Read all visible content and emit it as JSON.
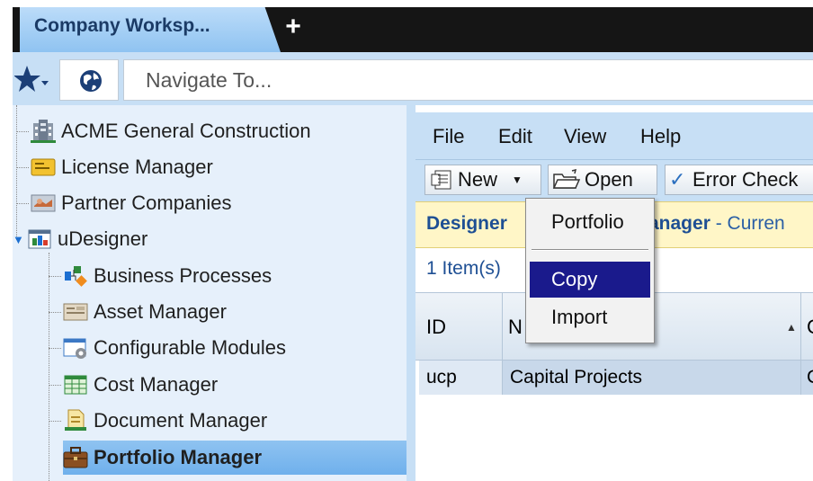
{
  "tab": {
    "title": "Company Worksp...",
    "add_label": "+"
  },
  "nav": {
    "placeholder": "Navigate To..."
  },
  "tree": {
    "items": [
      {
        "label": "ACME General Construction"
      },
      {
        "label": "License Manager"
      },
      {
        "label": "Partner Companies"
      },
      {
        "label": "uDesigner"
      },
      {
        "label": "Business Processes"
      },
      {
        "label": "Asset Manager"
      },
      {
        "label": "Configurable Modules"
      },
      {
        "label": "Cost Manager"
      },
      {
        "label": "Document Manager"
      },
      {
        "label": "Portfolio Manager"
      }
    ]
  },
  "menu": {
    "file": "File",
    "edit": "Edit",
    "view": "View",
    "help": "Help"
  },
  "toolbar": {
    "new": "New",
    "open": "Open",
    "error_check": "Error Check"
  },
  "designer": {
    "label": "Designer",
    "mgr": "anager",
    "current": "- Curren"
  },
  "grid": {
    "count": "1 Item(s)",
    "headers": {
      "id": "ID",
      "name": "N",
      "c": "C"
    },
    "rows": [
      {
        "id": "ucp",
        "name": "Capital Projects",
        "c": "C"
      }
    ]
  },
  "dropdown": {
    "items": [
      "Portfolio",
      "Copy",
      "Import"
    ],
    "highlighted": "Copy"
  },
  "colors": {
    "selected": "#8fc3f1",
    "menu_highlight": "#1a1a8c",
    "dark_tabstrip": "#151515"
  }
}
